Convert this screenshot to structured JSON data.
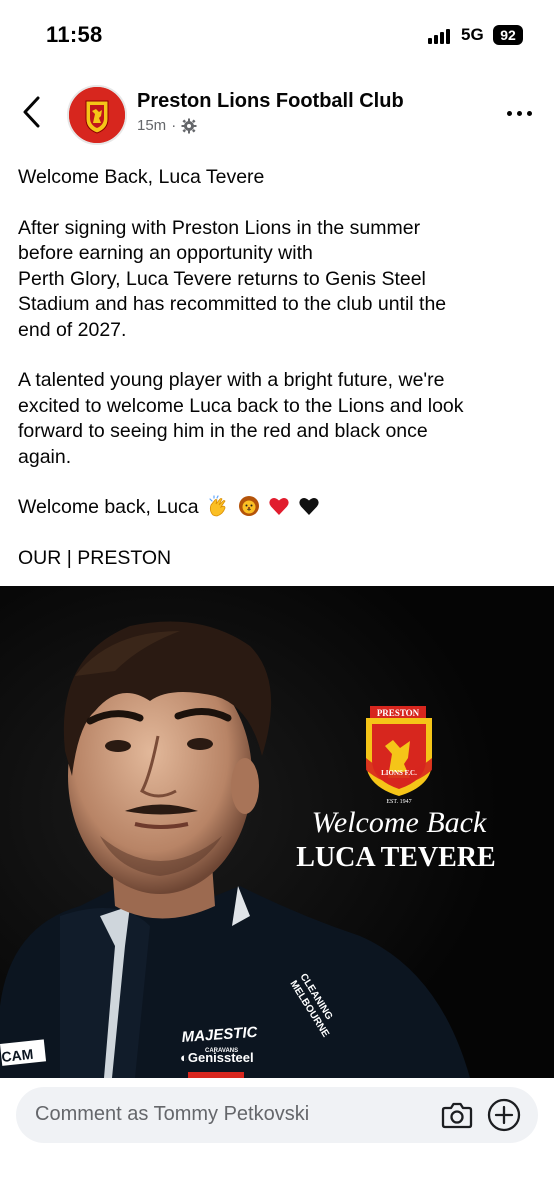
{
  "status": {
    "time": "11:58",
    "network": "5G",
    "battery": "92"
  },
  "header": {
    "page_name": "Preston Lions Football Club",
    "time_ago": "15m",
    "separator": "·"
  },
  "post": {
    "title": "Welcome Back, Luca Tevere",
    "paragraph1_line1": "After signing with Preston Lions in the summer",
    "paragraph1_line2": "before earning an opportunity with",
    "paragraph1_line3": "Perth Glory, Luca Tevere returns to Genis Steel",
    "paragraph1_line4": "Stadium and has recommitted to the club until the",
    "paragraph1_line5": "end of 2027.",
    "paragraph2_line1": "A talented young player with a bright future, we're",
    "paragraph2_line2": "excited to welcome Luca back to the Lions and look",
    "paragraph2_line3": "forward to seeing him in the red and black once",
    "paragraph2_line4": "again.",
    "sign_off": "Welcome back, Luca",
    "tagline": "OUR | PRESTON"
  },
  "image": {
    "crest_top": "PRESTON",
    "crest_bottom": "LIONS F.C.",
    "crest_est": "EST. 1947",
    "headline_script": "Welcome Back",
    "headline_name": "LUCA TEVERE",
    "sponsor_1": "MAJESTIC",
    "sponsor_1_sub": "CARAVANS",
    "sponsor_2": "Genissteel",
    "sponsor_3": "CLEANING MELBOURNE",
    "sponsor_4": "CAM"
  },
  "comment": {
    "placeholder": "Comment as Tommy Petkovski"
  },
  "colors": {
    "club_red": "#d7261e",
    "club_gold": "#f5c518",
    "text": "#050505",
    "muted": "#65676b",
    "input_bg": "#f0f2f5"
  }
}
